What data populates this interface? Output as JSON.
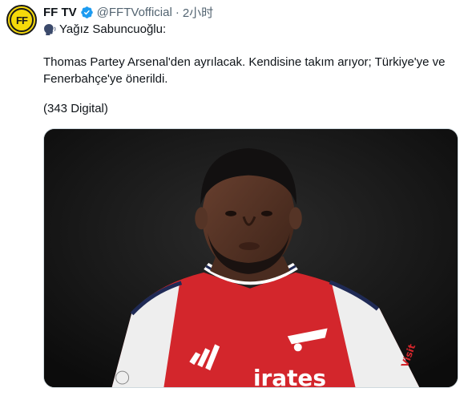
{
  "account": {
    "avatar_text": "FF",
    "name": "FF TV",
    "handle": "@FFTVofficial",
    "separator": "·",
    "time": "2小时"
  },
  "post": {
    "author_line": "Yağız Sabuncuoğlu:",
    "body": "Thomas Partey Arsenal'den ayrılacak. Kendisine takım arıyor; Türkiye'ye ve Fenerbahçe'ye önerildi.",
    "source": "(343 Digital)"
  },
  "media": {
    "jersey_text": "irates",
    "sleeve_text": "Visit"
  },
  "colors": {
    "verified": "#1d9bf0",
    "avatar_bg": "#f5d90a",
    "jersey_red": "#d3262c"
  }
}
